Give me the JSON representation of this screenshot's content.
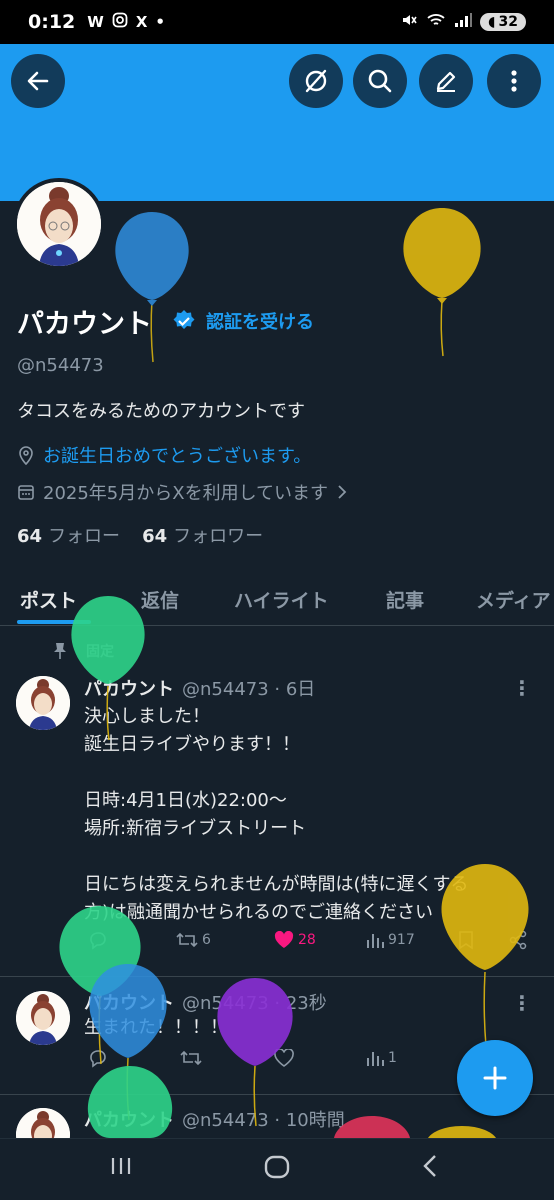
{
  "status_bar": {
    "time": "0:12",
    "left_icons": [
      "W",
      "instagram-icon",
      "X",
      "•"
    ],
    "battery": "32"
  },
  "header": {
    "buttons": [
      "back-arrow-icon",
      "grok-icon",
      "search-icon",
      "edit-icon",
      "more-vertical-icon"
    ],
    "banner_color": "#1d9bf0"
  },
  "profile": {
    "name": "パカウント",
    "verify_label": "認証を受ける",
    "handle": "@n54473",
    "bio": "タコスをみるためのアカウントです",
    "location": "お誕生日おめでとうございます。",
    "joined": "2025年5月からXを利用しています",
    "following_count": "64",
    "following_label": "フォロー",
    "followers_count": "64",
    "followers_label": "フォロワー"
  },
  "tabs": [
    "ポスト",
    "返信",
    "ハイライト",
    "記事",
    "メディア"
  ],
  "pinned_label": "固定",
  "posts": [
    {
      "name": "パカウント",
      "handle": "@n54473",
      "time": "· 6日",
      "body": "決心しました！\n誕生日ライブやります！！\n\n日時:4月1日(水)22:00〜\n場所:新宿ライブストリート\n\n日にちは変えられませんが時間は(特に遅くする\n方)は融通聞かせられるのでご連絡ください",
      "retweets": "6",
      "likes": "28",
      "views": "917",
      "liked": true
    },
    {
      "name": "パカウント",
      "handle": "@n54473",
      "time": "· 23秒",
      "body": "生まれた！！！！",
      "retweets": "",
      "likes": "",
      "views": "1",
      "liked": false
    },
    {
      "name": "パカウント",
      "handle": "@n54473",
      "time": "· 10時間"
    }
  ],
  "fab": "compose-plus-icon",
  "nav": [
    "recent-apps-icon",
    "home-icon",
    "back-icon"
  ],
  "colors": {
    "accent": "#1d9bf0",
    "background": "#15202b",
    "like": "#f91880",
    "balloon_blue": "#2f8fe0",
    "balloon_yellow": "#e0b80f",
    "balloon_green": "#2ed48a",
    "balloon_purple": "#8a2fd6",
    "balloon_red": "#e0335a"
  }
}
